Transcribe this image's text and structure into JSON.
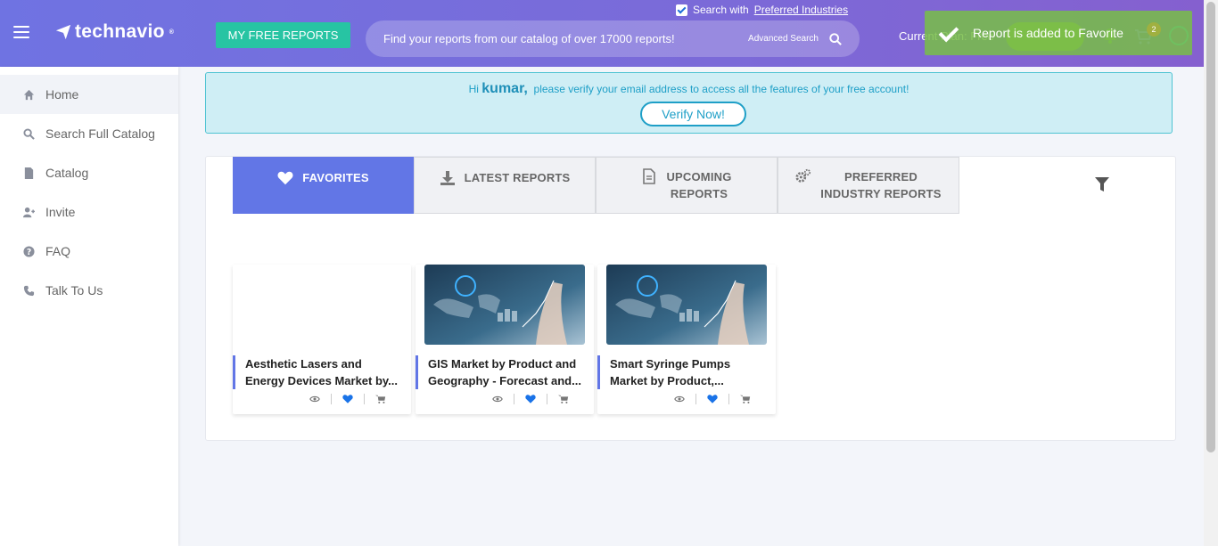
{
  "header": {
    "logo_text": "technavio",
    "logo_mark": "®",
    "free_reports_label": "MY FREE REPORTS",
    "search_with_label": "Search with",
    "preferred_industries_link": "Preferred Industries",
    "search_placeholder": "Find your reports from our catalog of over 17000 reports!",
    "advanced_search_label": "Advanced Search",
    "current_plan_label": "Current Plan: Free",
    "cart_count": "2",
    "toast_message": "Report is added to Favorite"
  },
  "sidebar": {
    "items": [
      {
        "label": "Home",
        "icon": "home-icon"
      },
      {
        "label": "Search Full Catalog",
        "icon": "search-icon"
      },
      {
        "label": "Catalog",
        "icon": "file-icon"
      },
      {
        "label": "Invite",
        "icon": "user-plus-icon"
      },
      {
        "label": "FAQ",
        "icon": "question-icon"
      },
      {
        "label": "Talk To Us",
        "icon": "phone-icon"
      }
    ]
  },
  "verify": {
    "greeting": "Hi",
    "user_name": "kumar,",
    "message": "please verify your email address to access all the features of your free account!",
    "button_label": "Verify Now!"
  },
  "tabs": [
    {
      "label": "FAVORITES",
      "icon": "heart-icon",
      "active": true
    },
    {
      "label": "LATEST REPORTS",
      "icon": "download-icon"
    },
    {
      "label_line1": "UPCOMING",
      "label_line2": "REPORTS",
      "icon": "document-icon"
    },
    {
      "label_line1": "PREFERRED",
      "label_line2": "INDUSTRY REPORTS",
      "icon": "gears-icon"
    }
  ],
  "reports": [
    {
      "title": "Aesthetic Lasers and Energy Devices Market by...",
      "has_image": false
    },
    {
      "title": "GIS Market by Product and Geography - Forecast and...",
      "has_image": true
    },
    {
      "title": "Smart Syringe Pumps Market by Product,...",
      "has_image": true
    }
  ],
  "colors": {
    "accent": "#6276e6",
    "green_button": "#27c4a3",
    "favorite_heart": "#1a73e8"
  }
}
